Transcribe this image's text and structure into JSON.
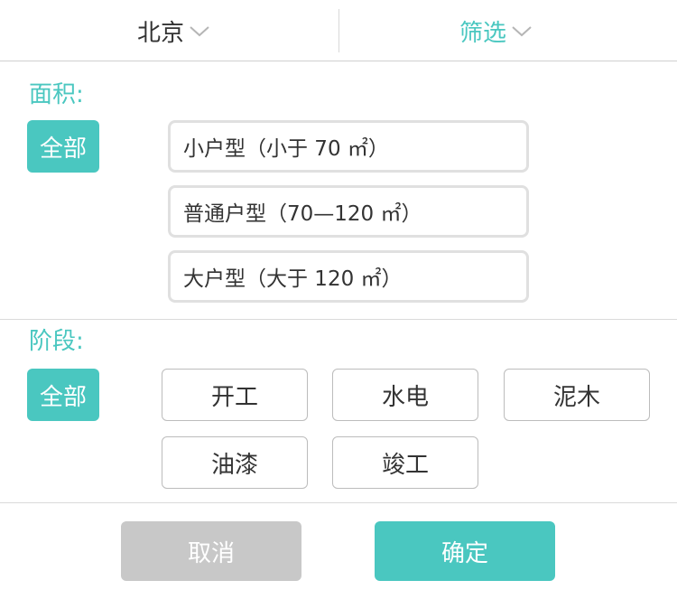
{
  "header": {
    "city_label": "北京",
    "filter_label": "筛选",
    "icons": [
      "chevron-down-icon",
      "chevron-down-icon"
    ]
  },
  "area": {
    "title": "面积:",
    "all_label": "全部",
    "options": [
      "小户型（小于 70 ㎡）",
      "普通户型（70—120 ㎡）",
      "大户型（大于 120 ㎡）"
    ]
  },
  "stage": {
    "title": "阶段:",
    "all_label": "全部",
    "options": [
      "开工",
      "水电",
      "泥木",
      "油漆",
      "竣工"
    ]
  },
  "actions": {
    "cancel_label": "取消",
    "confirm_label": "确定"
  },
  "colors": {
    "accent": "#4ac7c0",
    "cancel_bg": "#c8c8c8"
  }
}
